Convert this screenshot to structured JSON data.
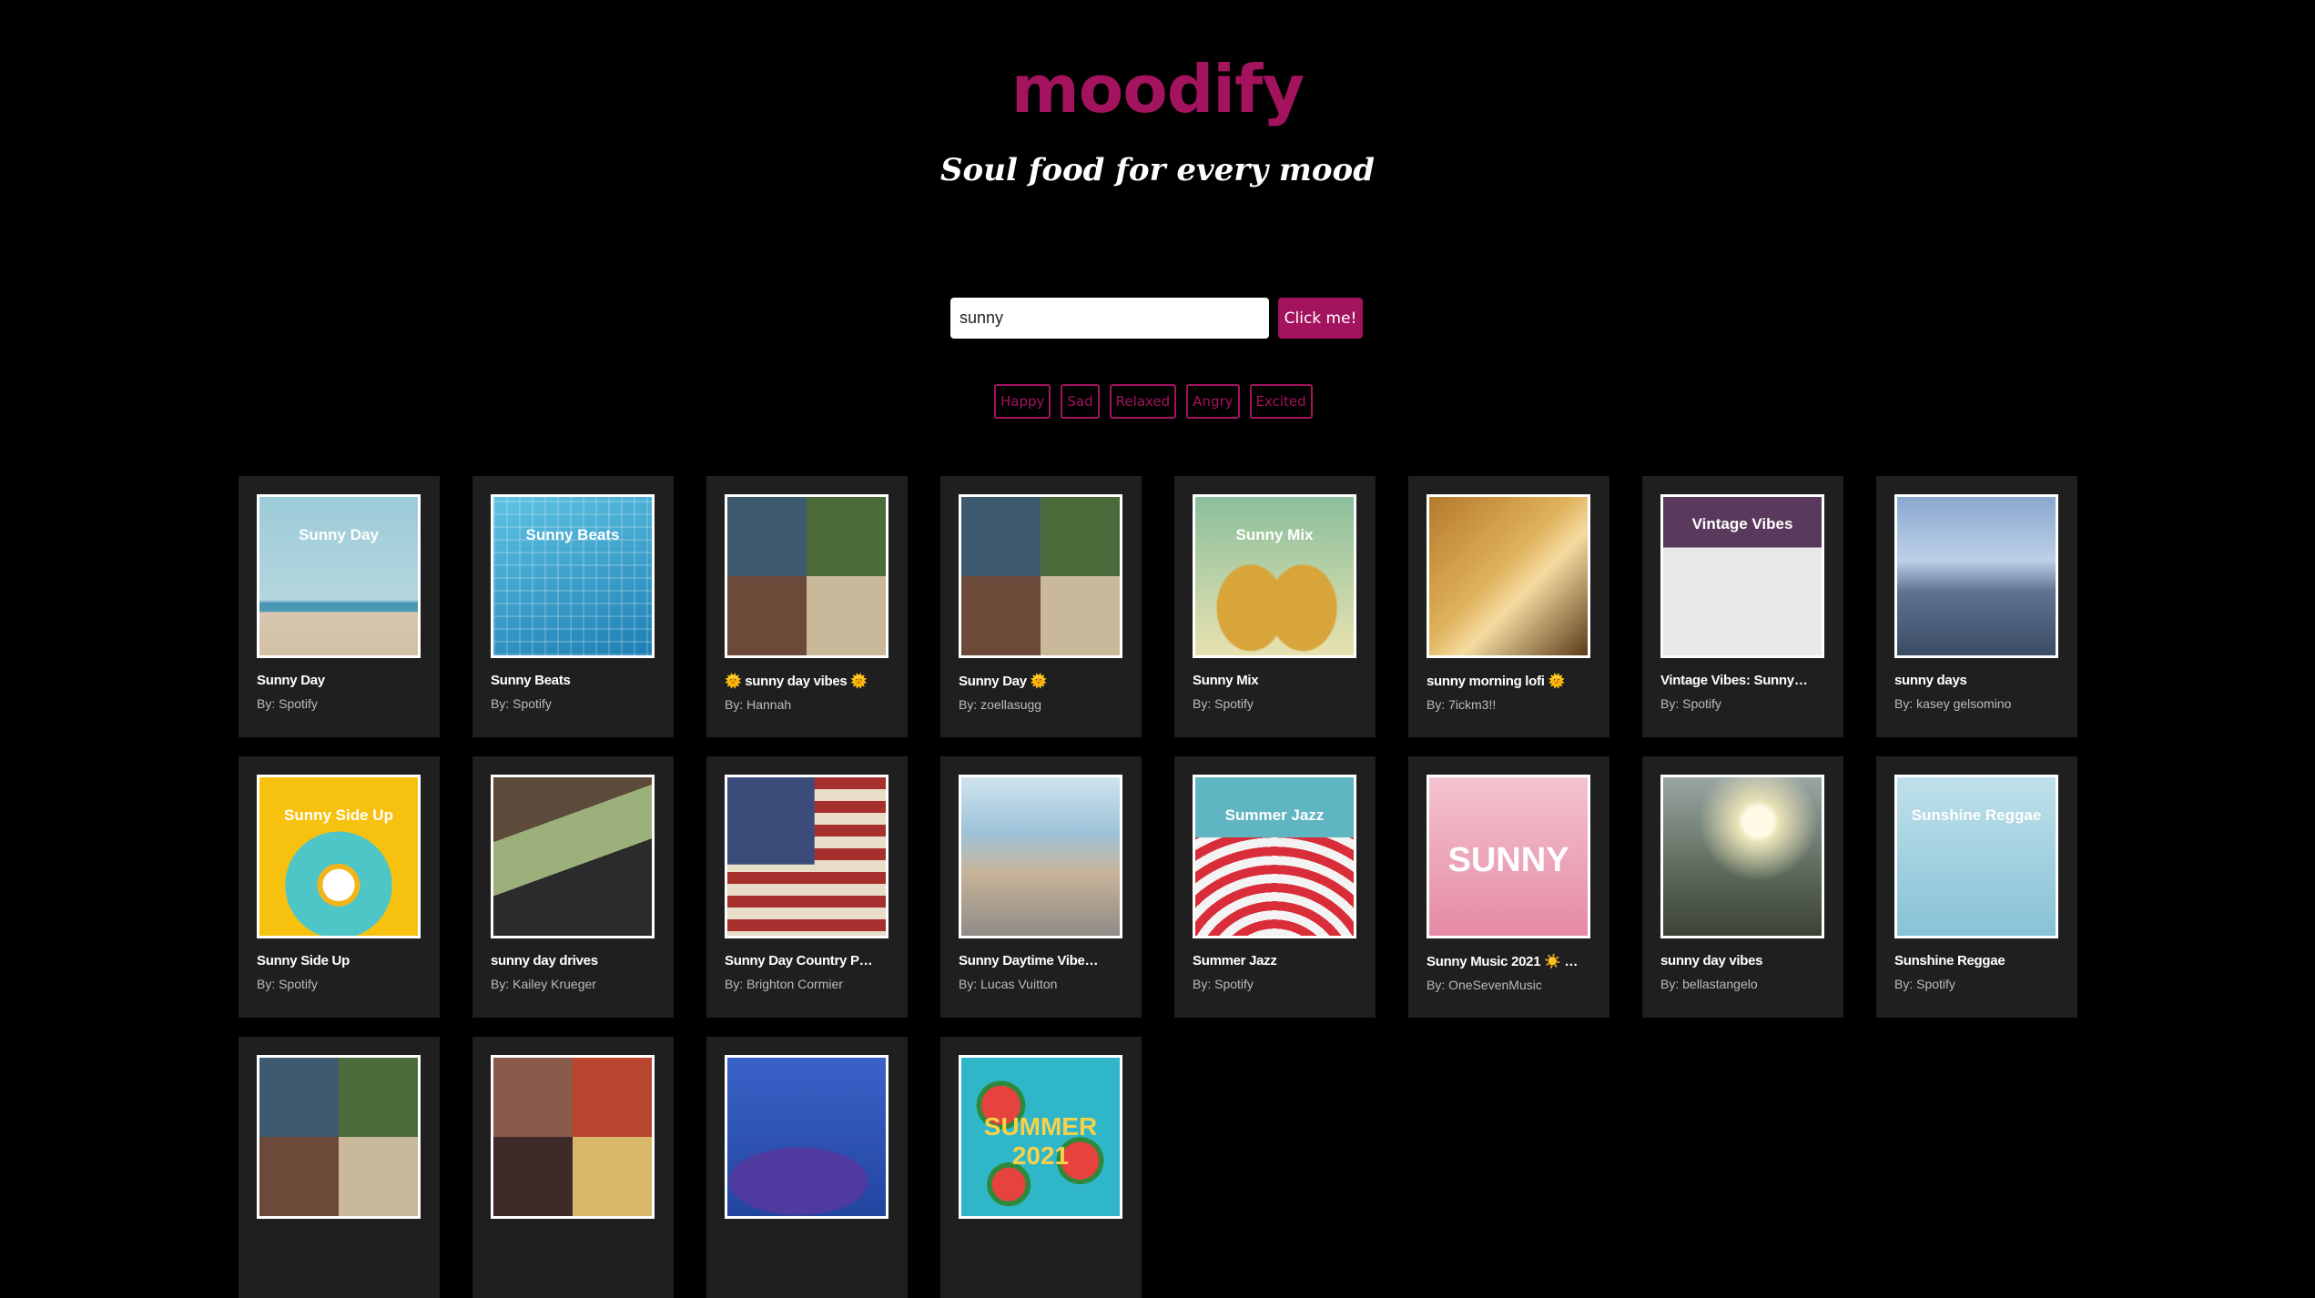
{
  "app": {
    "brand": "moodify",
    "tagline": "Soul food for every mood"
  },
  "search": {
    "value": "sunny",
    "button_label": "Click me!"
  },
  "moods": [
    "Happy",
    "Sad",
    "Relaxed",
    "Angry",
    "Excited"
  ],
  "colors": {
    "accent": "#a3135e",
    "background": "#000000",
    "card": "#1f1f1f"
  },
  "playlists": [
    {
      "title": "Sunny Day",
      "owner": "By: Spotify",
      "cover_text": "Sunny Day",
      "cover": "beach-lifeguard-tower"
    },
    {
      "title": "Sunny Beats",
      "owner": "By: Spotify",
      "cover_text": "Sunny Beats",
      "cover": "pool-palm-shadows"
    },
    {
      "title": "🌞 sunny day vibes 🌞",
      "owner": "By: Hannah",
      "cover_text": "",
      "cover": "album-collage"
    },
    {
      "title": "Sunny Day 🌞",
      "owner": "By: zoellasugg",
      "cover_text": "",
      "cover": "album-collage"
    },
    {
      "title": "Sunny Mix",
      "owner": "By: Spotify",
      "cover_text": "Sunny Mix",
      "cover": "pineapples"
    },
    {
      "title": "sunny morning lofi 🌞",
      "owner": "By: 7ickm3!!",
      "cover_text": "",
      "cover": "sunlit-room"
    },
    {
      "title": "Vintage Vibes: Sunny…",
      "owner": "By: Spotify",
      "cover_text": "Vintage Vibes",
      "cover": "vintage-dancer"
    },
    {
      "title": "sunny days",
      "owner": "By: kasey gelsomino",
      "cover_text": "",
      "cover": "city-street"
    },
    {
      "title": "Sunny Side Up",
      "owner": "By: Spotify",
      "cover_text": "Sunny Side Up",
      "cover": "breakfast-plate"
    },
    {
      "title": "sunny day drives",
      "owner": "By: Kailey Krueger",
      "cover_text": "",
      "cover": "car-drive"
    },
    {
      "title": "Sunny Day Country P…",
      "owner": "By: Brighton Cormier",
      "cover_text": "",
      "cover": "us-flag"
    },
    {
      "title": "Sunny Daytime Vibe…",
      "owner": "By: Lucas Vuitton",
      "cover_text": "",
      "cover": "anime-street"
    },
    {
      "title": "Summer Jazz",
      "owner": "By: Spotify",
      "cover_text": "Summer Jazz",
      "cover": "beach-umbrellas"
    },
    {
      "title": "Sunny Music 2021 ☀️ …",
      "owner": "By: OneSevenMusic",
      "cover_text": "SUNNY",
      "cover": "woman-visor"
    },
    {
      "title": "sunny day vibes",
      "owner": "By: bellastangelo",
      "cover_text": "",
      "cover": "sunset-road"
    },
    {
      "title": "Sunshine Reggae",
      "owner": "By: Spotify",
      "cover_text": "Sunshine Reggae",
      "cover": "palm-sky"
    },
    {
      "title": "",
      "owner": "",
      "cover_text": "",
      "cover": "album-collage"
    },
    {
      "title": "",
      "owner": "",
      "cover_text": "",
      "cover": "movie-collage"
    },
    {
      "title": "",
      "owner": "",
      "cover_text": "",
      "cover": "man-inflatable"
    },
    {
      "title": "",
      "owner": "",
      "cover_text": "SUMMER 2021",
      "cover": "watermelon"
    }
  ]
}
